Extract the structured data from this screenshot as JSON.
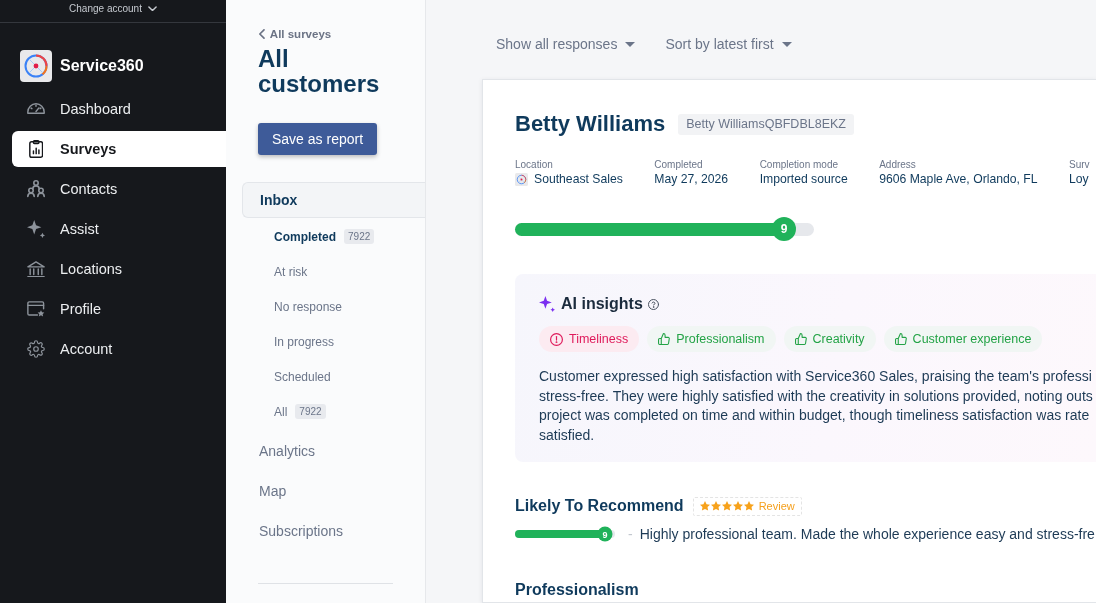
{
  "sidebar": {
    "account_switcher": "Change account",
    "brand": "Service360",
    "items": [
      {
        "label": "Dashboard",
        "selected": false
      },
      {
        "label": "Surveys",
        "selected": true
      },
      {
        "label": "Contacts",
        "selected": false
      },
      {
        "label": "Assist",
        "selected": false
      },
      {
        "label": "Locations",
        "selected": false
      },
      {
        "label": "Profile",
        "selected": false
      },
      {
        "label": "Account",
        "selected": false
      }
    ]
  },
  "survey_panel": {
    "back_link": "All surveys",
    "title": "All customers",
    "save_button": "Save as report",
    "sections": [
      {
        "label": "Inbox",
        "selected": true,
        "children": [
          {
            "label": "Completed",
            "selected": true,
            "count": "7922"
          },
          {
            "label": "At risk",
            "selected": false
          },
          {
            "label": "No response",
            "selected": false
          },
          {
            "label": "In progress",
            "selected": false
          },
          {
            "label": "Scheduled",
            "selected": false
          },
          {
            "label": "All",
            "selected": false,
            "count": "7922"
          }
        ]
      },
      {
        "label": "Analytics",
        "selected": false
      },
      {
        "label": "Map",
        "selected": false
      },
      {
        "label": "Subscriptions",
        "selected": false
      }
    ]
  },
  "toolbar": {
    "filters": [
      {
        "label": "Show all responses"
      },
      {
        "label": "Sort by latest first"
      }
    ]
  },
  "response": {
    "name": "Betty Williams",
    "tag": "Betty WilliamsQBFDBL8EKZ",
    "details": [
      {
        "label": "Location",
        "value": "Southeast Sales",
        "kind": "location"
      },
      {
        "label": "Completed",
        "value": "May 27, 2026",
        "kind": "text"
      },
      {
        "label": "Completion mode",
        "value": "Imported source",
        "kind": "text"
      },
      {
        "label": "Address",
        "value": "9606 Maple Ave, Orlando, FL",
        "kind": "text"
      },
      {
        "label": "Surv",
        "value": "Loy",
        "kind": "text"
      }
    ],
    "score": {
      "value": "9",
      "level": 0.9
    },
    "ai_insights": {
      "title": "AI insights",
      "topics": [
        {
          "label": "Timeliness",
          "kind": "negative"
        },
        {
          "label": "Professionalism",
          "kind": "positive"
        },
        {
          "label": "Creativity",
          "kind": "positive"
        },
        {
          "label": "Customer experience",
          "kind": "positive"
        }
      ],
      "summary_lines": [
        "Customer expressed high satisfaction with Service360 Sales, praising the team's professi",
        "stress-free. They were highly satisfied with the creativity in solutions provided, noting outs",
        "project was completed on time and within budget, though timeliness satisfaction was rate",
        "satisfied."
      ]
    },
    "questions": [
      {
        "title": "Likely To Recommend",
        "badge": {
          "stars": 5,
          "label": "Review"
        },
        "score": {
          "value": "9",
          "level": 0.9
        },
        "separator": "-",
        "comment": "Highly professional team. Made the whole experience easy and stress-fre"
      },
      {
        "title": "Professionalism"
      }
    ]
  }
}
